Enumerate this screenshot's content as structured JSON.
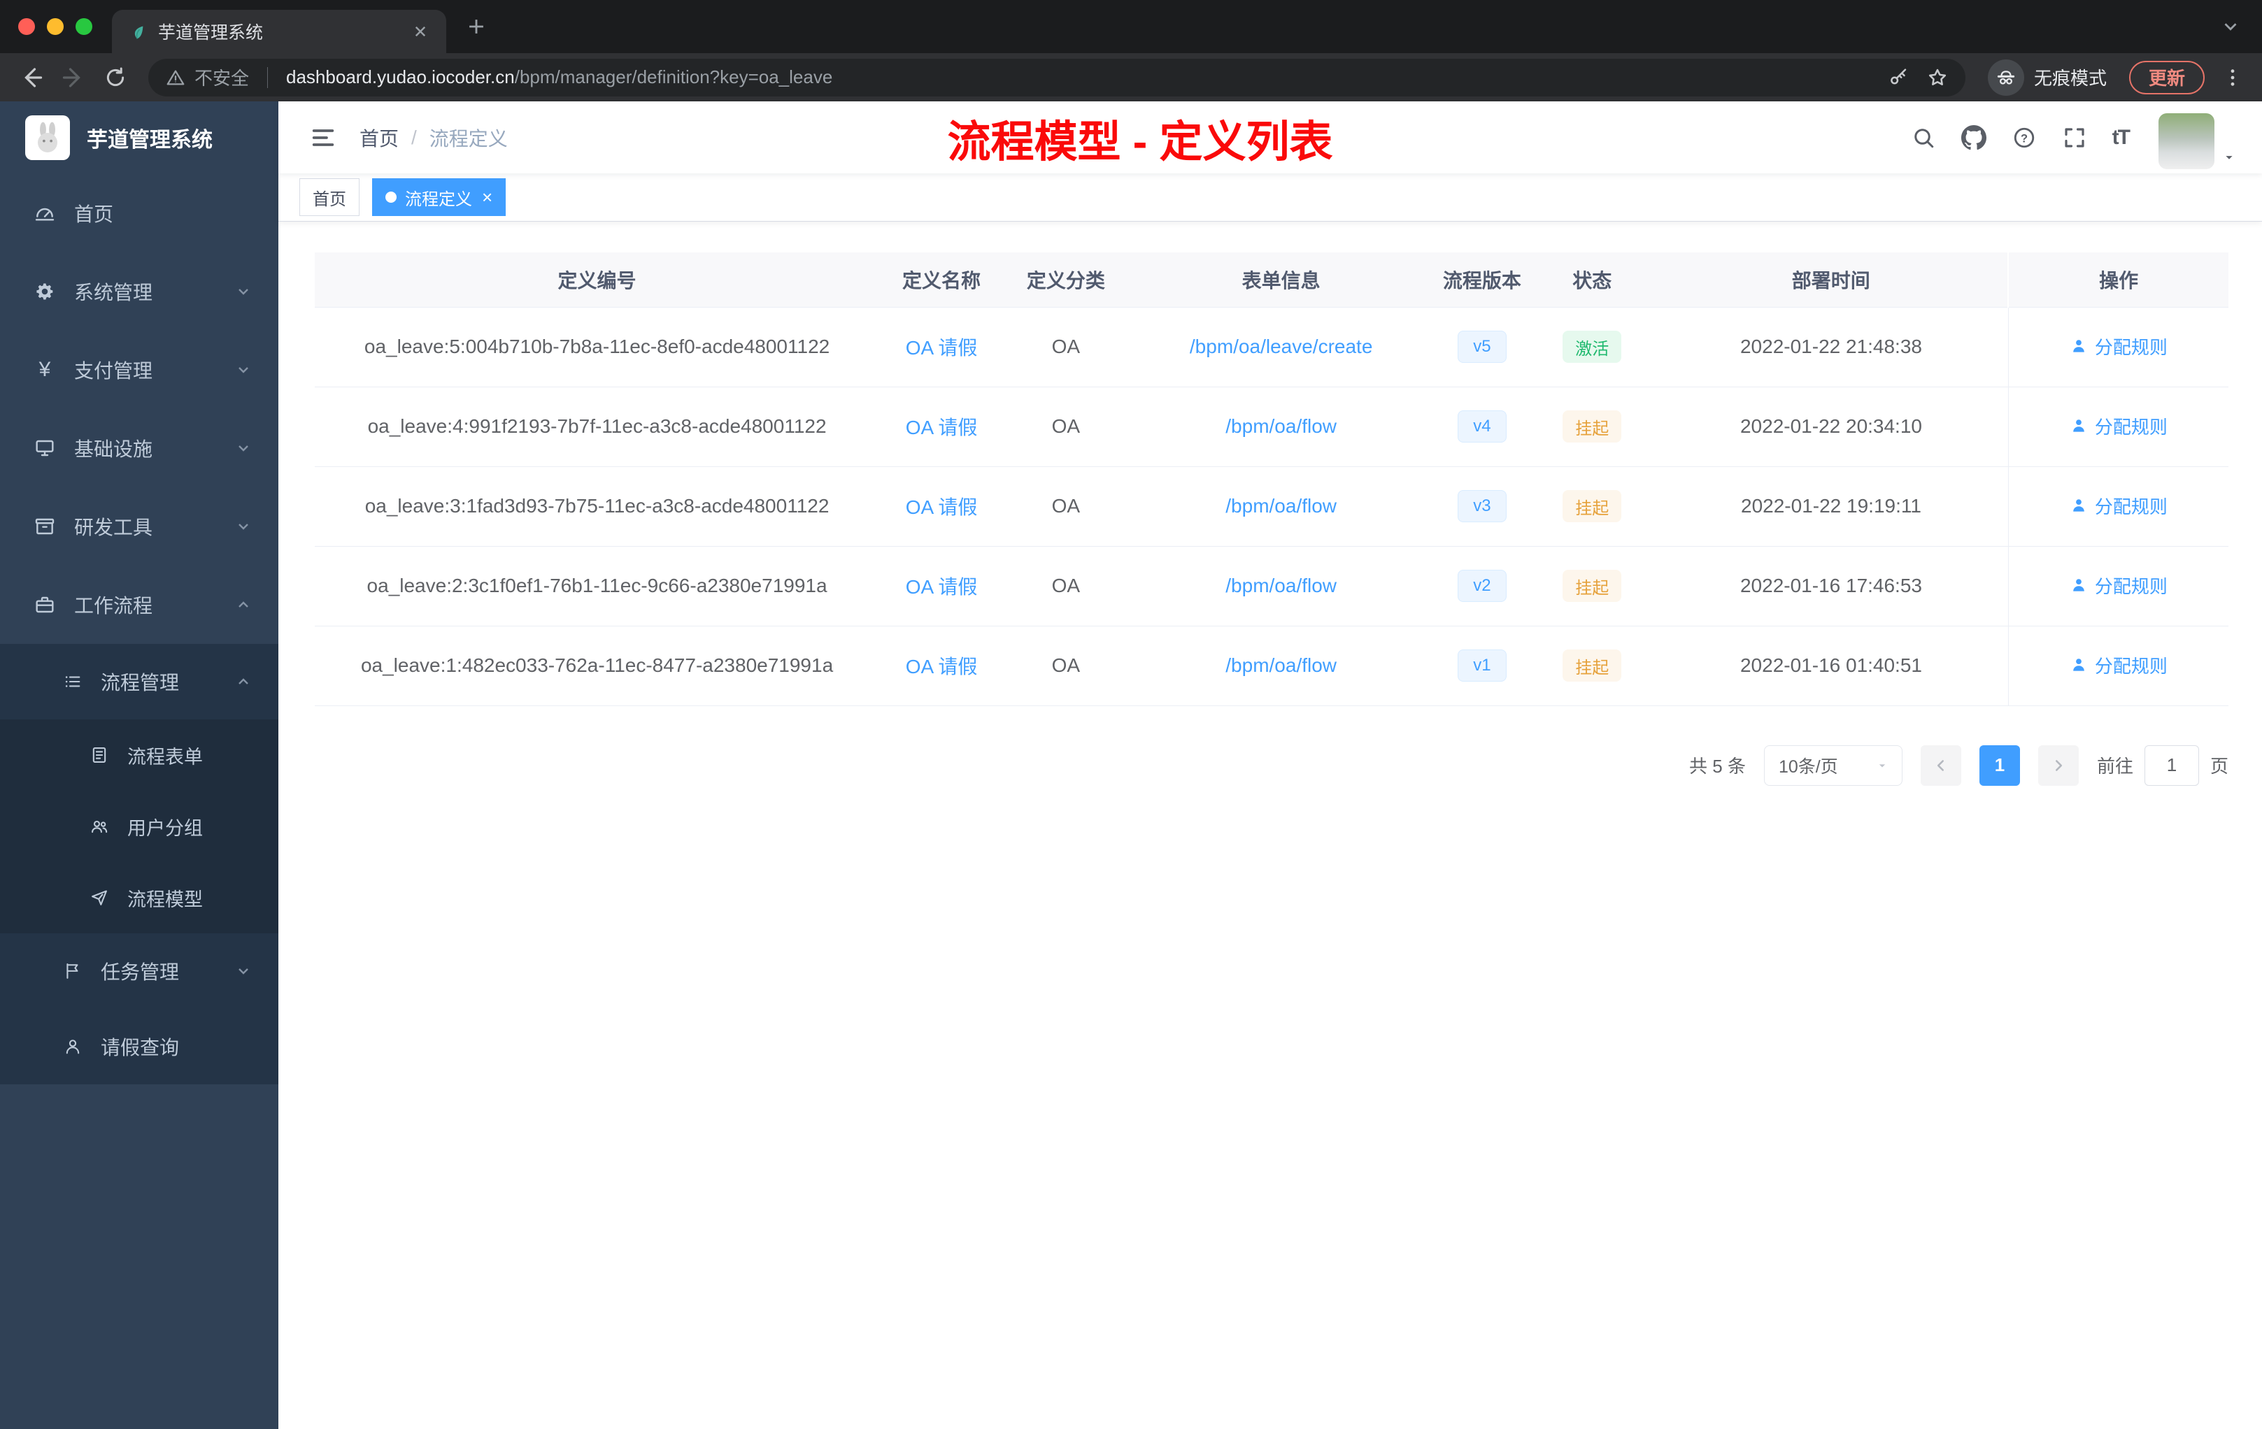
{
  "browser": {
    "tab_title": "芋道管理系统",
    "security_label": "不安全",
    "url_host": "dashboard.yudao.iocoder.cn",
    "url_path": "/bpm/manager/definition?key=oa_leave",
    "incognito_label": "无痕模式",
    "update_label": "更新"
  },
  "icons": {
    "payment": "¥",
    "font_size": "tT",
    "close": "×",
    "breadcrumb_separator": "/"
  },
  "colors": {
    "accent": "#409eff",
    "sidebar_bg": "#304156",
    "status_active": "#1fb96e",
    "status_suspended": "#e6a23c",
    "annotation_red": "#fa0a0a"
  },
  "sidebar": {
    "logo_title": "芋道管理系统",
    "menu": [
      {
        "label": "首页"
      },
      {
        "label": "系统管理"
      },
      {
        "label": "支付管理"
      },
      {
        "label": "基础设施"
      },
      {
        "label": "研发工具"
      },
      {
        "label": "工作流程"
      },
      {
        "label": "流程管理"
      },
      {
        "label": "流程表单"
      },
      {
        "label": "用户分组"
      },
      {
        "label": "流程模型"
      },
      {
        "label": "任务管理"
      },
      {
        "label": "请假查询"
      }
    ]
  },
  "navbar": {
    "breadcrumb": [
      "首页",
      "流程定义"
    ],
    "annotation": "流程模型 - 定义列表"
  },
  "tags": [
    {
      "label": "首页",
      "active": false
    },
    {
      "label": "流程定义",
      "active": true
    }
  ],
  "table": {
    "columns": [
      "定义编号",
      "定义名称",
      "定义分类",
      "表单信息",
      "流程版本",
      "状态",
      "部署时间",
      "操作"
    ],
    "rows": [
      {
        "id": "oa_leave:5:004b710b-7b8a-11ec-8ef0-acde48001122",
        "name": "OA 请假",
        "category": "OA",
        "form": "/bpm/oa/leave/create",
        "version": "v5",
        "status": "激活",
        "status_type": "active",
        "time": "2022-01-22 21:48:38",
        "action": "分配规则"
      },
      {
        "id": "oa_leave:4:991f2193-7b7f-11ec-a3c8-acde48001122",
        "name": "OA 请假",
        "category": "OA",
        "form": "/bpm/oa/flow",
        "version": "v4",
        "status": "挂起",
        "status_type": "suspended",
        "time": "2022-01-22 20:34:10",
        "action": "分配规则"
      },
      {
        "id": "oa_leave:3:1fad3d93-7b75-11ec-a3c8-acde48001122",
        "name": "OA 请假",
        "category": "OA",
        "form": "/bpm/oa/flow",
        "version": "v3",
        "status": "挂起",
        "status_type": "suspended",
        "time": "2022-01-22 19:19:11",
        "action": "分配规则"
      },
      {
        "id": "oa_leave:2:3c1f0ef1-76b1-11ec-9c66-a2380e71991a",
        "name": "OA 请假",
        "category": "OA",
        "form": "/bpm/oa/flow",
        "version": "v2",
        "status": "挂起",
        "status_type": "suspended",
        "time": "2022-01-16 17:46:53",
        "action": "分配规则"
      },
      {
        "id": "oa_leave:1:482ec033-762a-11ec-8477-a2380e71991a",
        "name": "OA 请假",
        "category": "OA",
        "form": "/bpm/oa/flow",
        "version": "v1",
        "status": "挂起",
        "status_type": "suspended",
        "time": "2022-01-16 01:40:51",
        "action": "分配规则"
      }
    ]
  },
  "pagination": {
    "total": "共 5 条",
    "page_size": "10条/页",
    "current_page": "1",
    "goto_label": "前往",
    "goto_value": "1",
    "page_label": "页"
  }
}
